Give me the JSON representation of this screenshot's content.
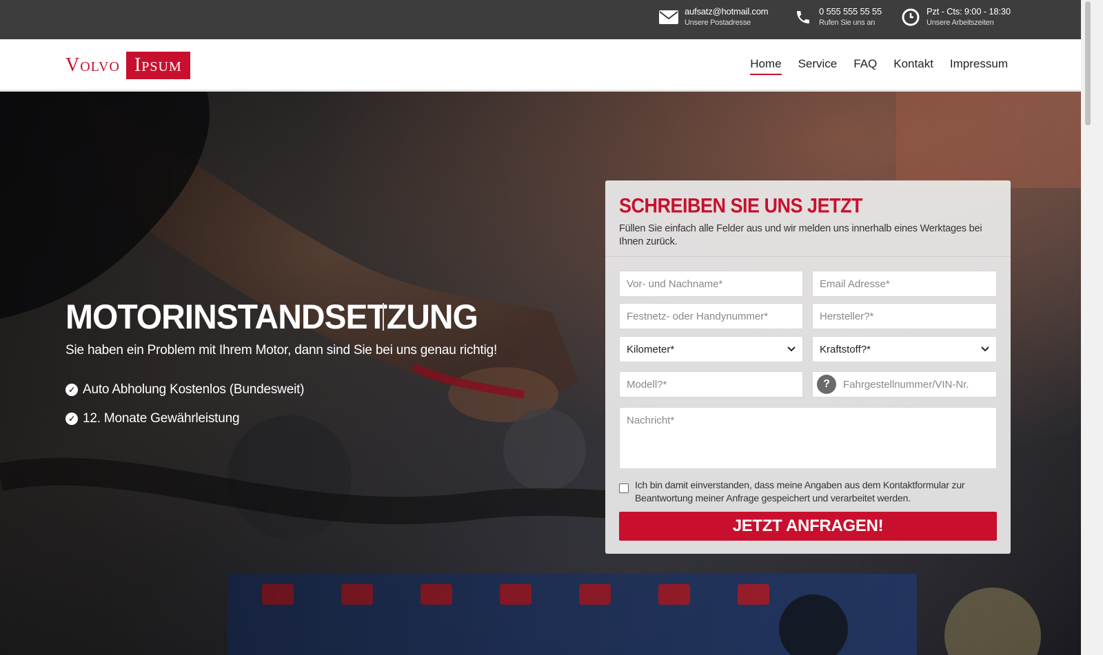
{
  "topbar": {
    "email": {
      "icon": "envelope-icon",
      "main": "aufsatz@hotmail.com",
      "sub": "Unsere Postadresse"
    },
    "phone": {
      "icon": "phone-icon",
      "main": "0 555 555 55 55",
      "sub": "Rufen Sie uns an"
    },
    "hours": {
      "icon": "clock-icon",
      "main": "Pzt - Cts: 9:00 - 18:30",
      "sub": "Unsere Arbeitszeiten"
    }
  },
  "header": {
    "logo_part1": "Volvo",
    "logo_part2": "Ipsum",
    "nav": [
      "Home",
      "Service",
      "FAQ",
      "Kontakt",
      "Impressum"
    ],
    "active_nav": "Home"
  },
  "hero": {
    "title": "MOTORINSTANDSETZUNG",
    "subtitle": "Sie haben ein Problem mit Ihrem Motor, dann sind Sie bei uns genau richtig!",
    "bullets": [
      "Auto Abholung Kostenlos (Bundesweit)",
      "12. Monate Gewährleistung"
    ]
  },
  "form": {
    "title": "SCHREIBEN SIE UNS JETZT",
    "description": "Füllen Sie einfach alle Felder aus und wir melden uns innerhalb eines Werktages bei Ihnen zurück.",
    "name_placeholder": "Vor- und Nachname*",
    "email_placeholder": "Email Adresse*",
    "phone_placeholder": "Festnetz- oder Handynummer*",
    "manufacturer_placeholder": "Hersteller?*",
    "mileage_select": "Kilometer*",
    "fuel_select": "Kraftstoff?*",
    "model_placeholder": "Modell?*",
    "vin_placeholder": "Fahrgestellnummer/VIN-Nr.",
    "vin_help": "?",
    "message_placeholder": "Nachricht*",
    "consent_text": "Ich bin damit einverstanden, dass meine Angaben aus dem Kontaktformular zur Beantwortung meiner Anfrage gespeichert und verarbeitet werden.",
    "submit_label": "JETZT ANFRAGEN!"
  },
  "colors": {
    "brand_red": "#c8102e",
    "topbar_bg": "#3d3d3d"
  }
}
